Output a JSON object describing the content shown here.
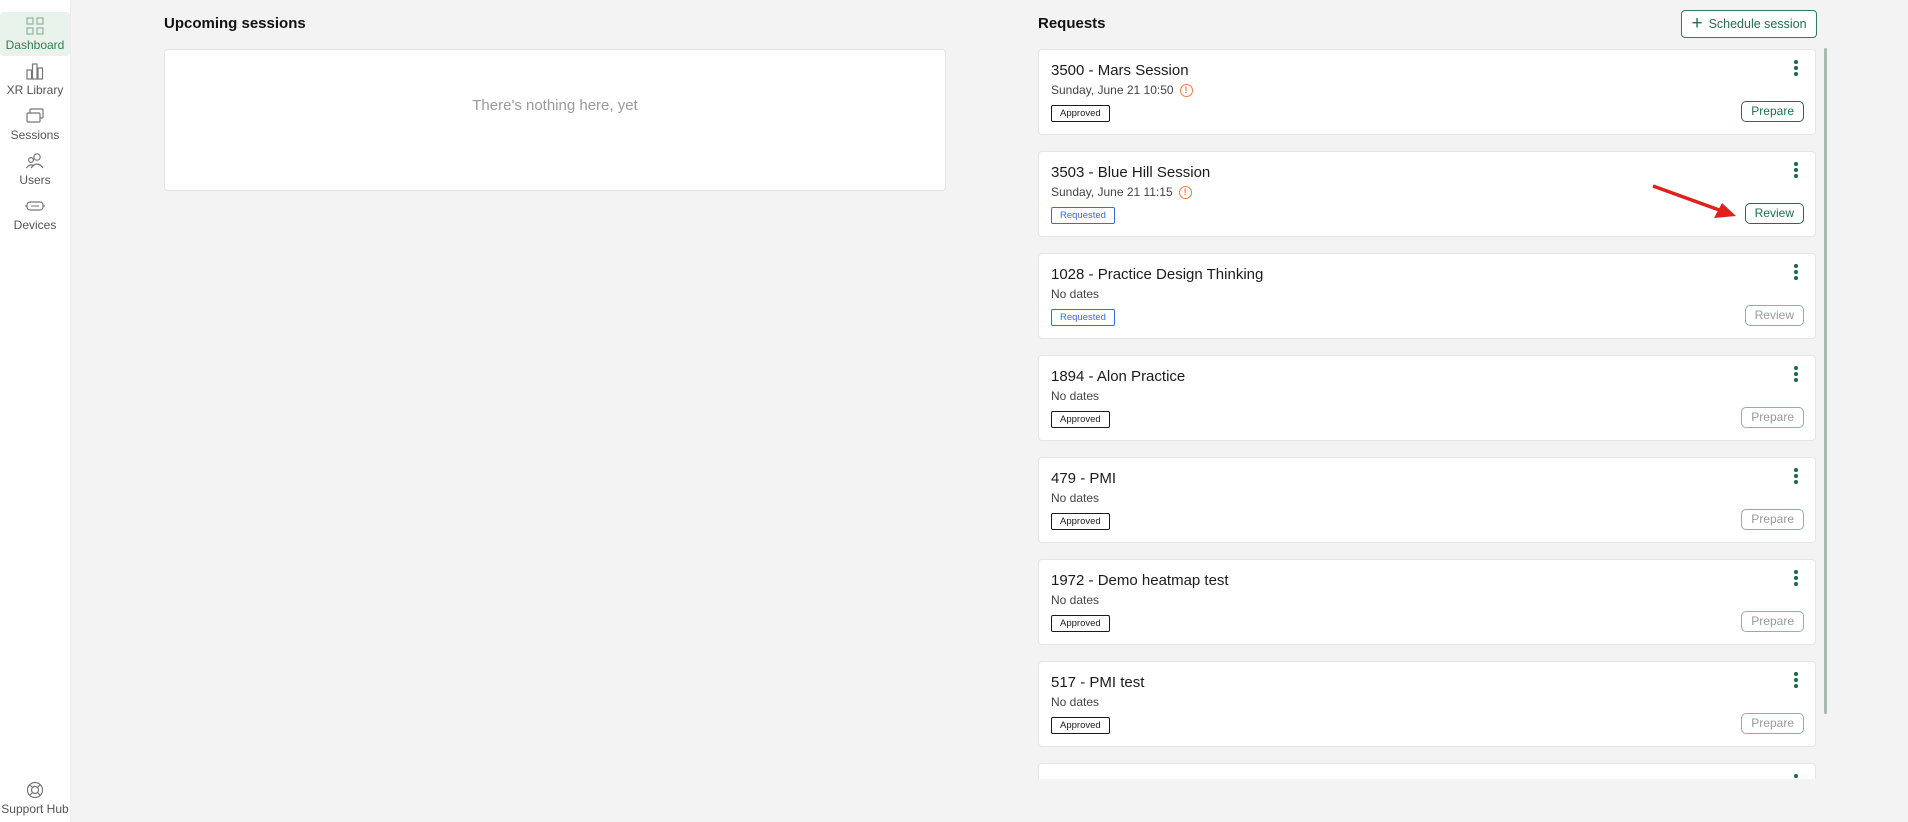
{
  "sidebar": {
    "items": [
      {
        "label": "Dashboard",
        "icon": "dashboard-icon",
        "active": true
      },
      {
        "label": "XR Library",
        "icon": "chart-icon"
      },
      {
        "label": "Sessions",
        "icon": "sessions-icon"
      },
      {
        "label": "Users",
        "icon": "users-icon"
      },
      {
        "label": "Devices",
        "icon": "headset-icon"
      }
    ],
    "support": {
      "label": "Support Hub",
      "icon": "lifebuoy-icon"
    }
  },
  "upcoming": {
    "title": "Upcoming sessions",
    "empty_text": "There's nothing here, yet"
  },
  "requests": {
    "title": "Requests",
    "schedule_label": "Schedule session",
    "items": [
      {
        "title": "3500 - Mars Session",
        "date": "Sunday, June 21  10:50",
        "warning": true,
        "status": "Approved",
        "action": "Prepare",
        "action_enabled": true
      },
      {
        "title": "3503 - Blue Hill Session",
        "date": "Sunday, June 21  11:15",
        "warning": true,
        "status": "Requested",
        "action": "Review",
        "action_enabled": true
      },
      {
        "title": "1028 - Practice Design Thinking",
        "date": "No dates",
        "warning": false,
        "status": "Requested",
        "action": "Review",
        "action_enabled": false
      },
      {
        "title": "1894 - Alon Practice",
        "date": "No dates",
        "warning": false,
        "status": "Approved",
        "action": "Prepare",
        "action_enabled": false
      },
      {
        "title": "479 - PMI",
        "date": "No dates",
        "warning": false,
        "status": "Approved",
        "action": "Prepare",
        "action_enabled": false
      },
      {
        "title": "1972 - Demo heatmap test",
        "date": "No dates",
        "warning": false,
        "status": "Approved",
        "action": "Prepare",
        "action_enabled": false
      },
      {
        "title": "517 - PMI test",
        "date": "No dates",
        "warning": false,
        "status": "Approved",
        "action": "Prepare",
        "action_enabled": false
      }
    ]
  },
  "colors": {
    "accent": "#1f6e4c",
    "requested": "#2f6fe0",
    "warning": "#f07d3a",
    "annotation_arrow": "#e0201c"
  }
}
